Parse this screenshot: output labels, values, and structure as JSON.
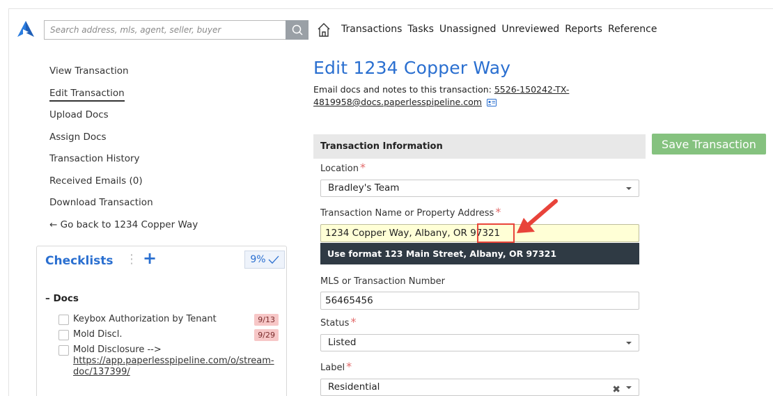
{
  "topbar": {
    "search_placeholder": "Search address, mls, agent, seller, buyer",
    "nav": [
      "Transactions",
      "Tasks",
      "Unassigned",
      "Unreviewed",
      "Reports",
      "Reference"
    ]
  },
  "sidebar": {
    "links": [
      {
        "label": "View Transaction"
      },
      {
        "label": "Edit Transaction",
        "active": true
      },
      {
        "label": "Upload Docs"
      },
      {
        "label": "Assign Docs"
      },
      {
        "label": "Transaction History"
      },
      {
        "label": "Received Emails (0)"
      },
      {
        "label": "Download Transaction"
      },
      {
        "label": "← Go back to 1234 Copper Way"
      }
    ]
  },
  "checklists": {
    "title": "Checklists",
    "percent": "9%",
    "group": "– Docs",
    "items": [
      {
        "text": "Keybox Authorization by Tenant",
        "badge": "9/13"
      },
      {
        "text": "Mold Discl.",
        "badge": "9/29"
      },
      {
        "text_line1": "Mold Disclosure -->",
        "link": "https://app.paperlesspipeline.com/o/stream-doc/137399/"
      }
    ]
  },
  "main": {
    "title": "Edit 1234 Copper Way",
    "email_prefix": "Email docs and notes to this transaction:",
    "email": "5526-150242-TX-4819958@docs.paperlesspipeline.com",
    "section": "Transaction Information",
    "save_label": "Save Transaction",
    "location_label": "Location",
    "location_value": "Bradley's Team",
    "address_label": "Transaction Name or Property Address",
    "address_value": "1234 Copper Way, Albany, OR 97321",
    "address_hint": "Use format 123 Main Street, Albany, OR 97321",
    "mls_label": "MLS or Transaction Number",
    "mls_value": "56465456",
    "status_label": "Status",
    "status_value": "Listed",
    "label_label": "Label",
    "label_value": "Residential"
  },
  "colors": {
    "accent": "#2a6fd0",
    "save": "#85c27f",
    "tooltip": "#2f3a44",
    "highlight": "#e8433a",
    "warn_bg": "#ffffd6"
  }
}
